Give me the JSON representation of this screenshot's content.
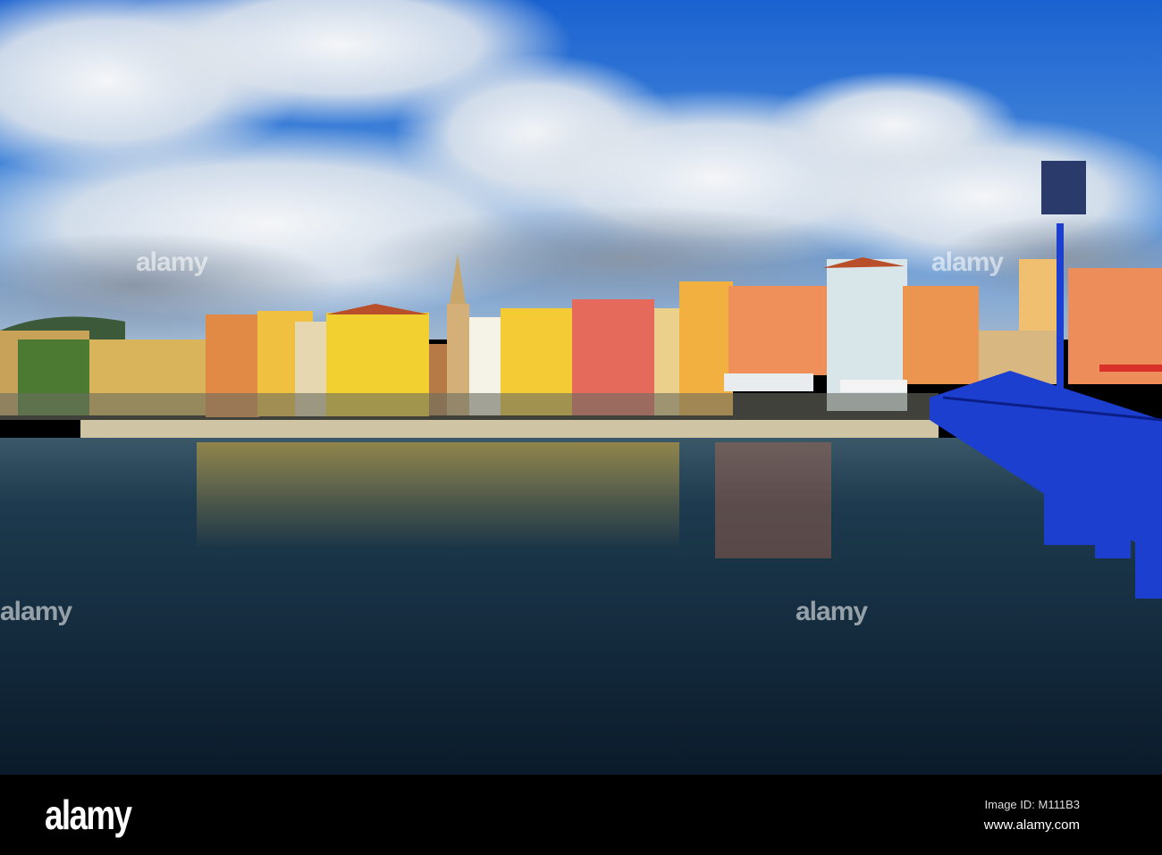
{
  "footer": {
    "logo": "alamy",
    "image_id": "Image ID: M111B3",
    "url": "www.alamy.com"
  },
  "watermark": "alamy",
  "colors": {
    "sky": "#1f6fd6",
    "water": "#0f2a40",
    "bridge": "#1d3fd0"
  }
}
